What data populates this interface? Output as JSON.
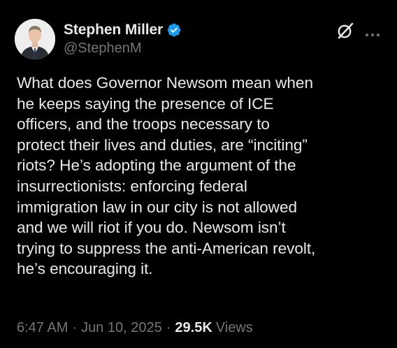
{
  "author": {
    "display_name": "Stephen Miller",
    "handle": "@StephenM",
    "verified": true,
    "verified_color": "#1d9bf0",
    "avatar_icon": "profile-photo"
  },
  "actions": {
    "grok_icon": "grok-icon",
    "more_icon": "more-options-icon"
  },
  "tweet": {
    "text": "What does Governor Newsom mean when\nhe keeps saying the presence of ICE\nofficers, and the troops necessary to\nprotect their lives and duties, are “inciting”\nriots? He’s adopting the argument of the\ninsurrectionists: enforcing federal\nimmigration law in our city is not allowed\nand we will riot if you do. Newsom isn’t\ntrying to suppress the anti-American revolt,\nhe’s encouraging it."
  },
  "meta": {
    "time": "6:47 AM",
    "separator": "·",
    "date": "Jun 10, 2025",
    "views_count": "29.5K",
    "views_label": "Views"
  },
  "colors": {
    "background": "#000000",
    "primary_text": "#e7e9ea",
    "secondary_text": "#71767b"
  }
}
